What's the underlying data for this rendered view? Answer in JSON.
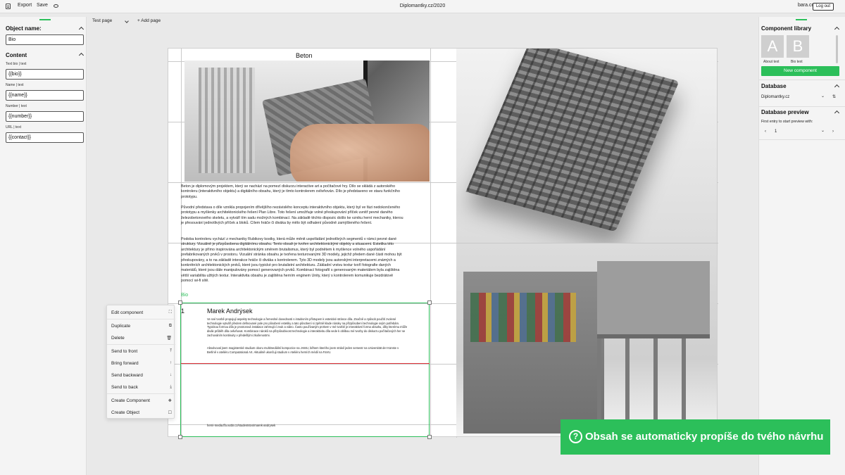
{
  "topbar": {
    "export": "Export",
    "save": "Save",
    "title": "Diplomantky.cz/2020",
    "user": "bara.co",
    "logout": "Log out"
  },
  "left_panel": {
    "object_name_heading": "Object name:",
    "object_name_value": "Bio",
    "content_heading": "Content",
    "fields": [
      {
        "label": "Text bio | text",
        "value": "{{bio}}"
      },
      {
        "label": "Name | text",
        "value": "{{name}}"
      },
      {
        "label": "Number | text",
        "value": "{{number}}"
      },
      {
        "label": "URL | text",
        "value": "{{contact}}"
      }
    ]
  },
  "canvas": {
    "page_select": "Test page",
    "add_page": "Add page",
    "beton_title": "Beton",
    "intro": "Beton je diplomovým projektem, který se nachází na pomezí diskurzu interactive art a počítačové hry. Dílo se skládá z autorského kontroleru (interaktivního objektu) a digitálního obsahu, který je tímto kontrolerem ovlivňován. Dílo je představeno ve stavu funkčního prototypu.",
    "para2": "Původní představa o díle vznikla propojením dřívějšího nezávislého konceptu interaktivního objektu, který byl ve fázi nedokončeného prototypu a myšlenky architektonického řešení Plan Libre. Toto řešení umožňuje volné přeskupování příček uvnitř pevné daného železobetonového skeletu, a vytváří tím sadu možných kombinací. Na základě těchto dispozic došlo ke vzniku herní mechaniky, kterou je přesouvání jednotlivých příček a bloků. Cílem hráče či diváka by mělo být odhalení původně zamýšleného řešení.",
    "para3": "Podoba kontroleru vychází z mechaniky Rubikovy kostky, která může měnit uspořádání jednotlivých segmentů v rámci pevné dané struktury. Vizuálně je přizpůsobena digitálnímu obsahu. Tento obsah je tvořen architektonickými objekty a situacemi. Estetika této architektury je přímo inspirována architektonickým směrem brutalismus, který byl podnětem k myšlence volného uspořádání prefabrikovaných prvků v prostoru. Vizuální stránka obsahu je tvořena texturovanými 3D modely, jejichž předem dané části mohou být přeskupovány, a to na základě interakce hráče či diváka s kontrolerem. Tyto 3D modely jsou autorskými interpretacemi známých a konkrétních architektonických prvků, které jsou typické pro brutalistní architekturu. Základní vrstvu textur tvoří fotografie daných materiálů, které jsou dále manipulovány pomocí generovaných prvků. Kombinací fotografií s generovaným materiálem byla zajištěna větší variabilita užitých textur. Interaktivita obsahu je zajištěna herním enginem Unity, který s kontrolerem komunikuje bezdrátově pomocí wi-fi sítě.",
    "bio_label": "Bio",
    "bio_number": "1",
    "bio_name": "Marek Andrýsek",
    "bio_p1": "Ve své tvorbě propojují aspekty technologie a řemeslné dovednosti s intuitivním přístupem k estetické stránce díla. Značně a způsob použití zvolené technologie vytváří předem definované pole pro působení estetiky a tato působení si zpětně klade nároky na přizpůsobení technologie svým potřebám. Typickou formou díla je prostorová instalace zahrnující zvuk a video. Často používaným prvkem v mé tvorbě je interaktivní forma obsahu, díky kterému může divák průběh díla ovlivňovat. Kombinace nároků na přizpůsobivost technologie a interaktivitu díla vede k oblibou mé tvorby do diskurzu počítačových her se zachováním kontinuity v předešlými zkušenostmi.",
    "bio_p2": "Absolvoval jsem magisterské studium oboru multimediální kompozice na JAMU, během kterého jsem strávil jeden semestr na Universität der Künste v Berlíně v ateliéru Computational Art. Aktuálně ukončuji studium v Ateliéru herních médií na FaVU.",
    "bio_link": "herni-media.ffa.vutbr.cz/studentstvo/marek-andrysek"
  },
  "context_menu": {
    "items": [
      {
        "label": "Edit component",
        "icon": "expand-icon",
        "glyph": "⛶"
      },
      {
        "label": "Duplicate",
        "icon": "copy-icon",
        "glyph": "⧉"
      },
      {
        "label": "Delete",
        "icon": "trash-icon",
        "glyph": "🗑"
      },
      {
        "label": "Send to front",
        "icon": "arrow-up-to-line-icon",
        "glyph": "⤒"
      },
      {
        "label": "Bring forward",
        "icon": "arrow-up-icon",
        "glyph": "↑"
      },
      {
        "label": "Send backward",
        "icon": "arrow-down-icon",
        "glyph": "↓"
      },
      {
        "label": "Send to back",
        "icon": "arrow-down-to-line-icon",
        "glyph": "⤓"
      },
      {
        "label": "Create Component",
        "icon": "component-icon",
        "glyph": "❖"
      },
      {
        "label": "Create Object",
        "icon": "square-icon",
        "glyph": "☐"
      }
    ]
  },
  "right_panel": {
    "library_heading": "Component library",
    "tiles": [
      {
        "glyph": "A",
        "caption": "About text"
      },
      {
        "glyph": "B",
        "caption": "Bio text"
      }
    ],
    "new_component": "New component",
    "database_heading": "Database",
    "database_value": "Diplomantky.cz",
    "preview_heading": "Database preview",
    "preview_hint": "First entry to start preview with:",
    "preview_value": "1"
  },
  "toast": {
    "icon": "?",
    "message": "Obsah se automaticky propíše do tvého návrhu"
  },
  "colors": {
    "accent": "#2cbf5a",
    "guide_red": "#e0343a"
  }
}
